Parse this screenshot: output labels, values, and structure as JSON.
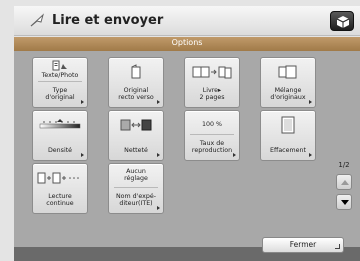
{
  "title": "Lire et envoyer",
  "options_header": "Options",
  "tiles": {
    "type_original": {
      "value": "Texte/Photo",
      "label": "Type\nd'original"
    },
    "recto_verso": {
      "label": "Original\nrecto verso"
    },
    "livre": {
      "label": "Livre▸\n2 pages"
    },
    "melange": {
      "label": "Mélange\nd'originaux"
    },
    "densite": {
      "label": "Densité"
    },
    "nettete": {
      "label": "Netteté"
    },
    "taux": {
      "value": "100 %",
      "label": "Taux de\nreproduction"
    },
    "effacement": {
      "label": "Effacement"
    },
    "lecture": {
      "label": "Lecture\ncontinue"
    },
    "nom_expediteur": {
      "value": "Aucun\nréglage",
      "label": "Nom d'expé-\nditeur(ITE)"
    }
  },
  "pager": {
    "page": "1/2"
  },
  "close_label": "Fermer"
}
